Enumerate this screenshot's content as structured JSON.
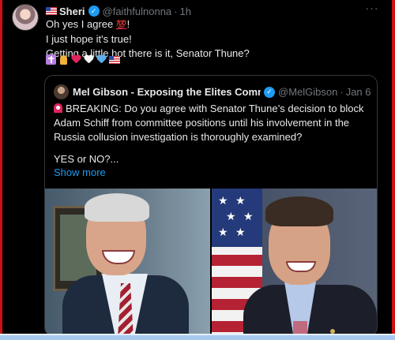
{
  "tweet": {
    "author_name": "Sheri",
    "handle": "@faithfulnonna",
    "separator": "·",
    "time": "1h",
    "more_label": "···",
    "lines": {
      "line1_text": "Oh yes I agree ",
      "line1_emoji": "💯",
      "line1_end": "!",
      "line2": "I just hope it's true!",
      "line3": "Getting a little hot there is it, Senator Thune?"
    },
    "emojis": [
      "latin-cross",
      "folded-hands",
      "red-heart",
      "white-heart",
      "blue-heart",
      "us-flag"
    ]
  },
  "quote": {
    "author_name": "Mel Gibson - Exposing the Elites Comment",
    "handle": "@MelGibson",
    "separator": "·",
    "date": "Jan 6",
    "text": "BREAKING: Do you agree with Senator Thune’s decision to block Adam Schiff from committee positions until his involvement in the Russia collusion investigation is thoroughly examined?",
    "question": "YES or NO?...",
    "show_more": "Show more",
    "media": [
      {
        "subject": "smiling man with white hair, navy suit and striped tie"
      },
      {
        "subject": "man in dark suit in front of American flag"
      }
    ]
  },
  "colors": {
    "background": "#000000",
    "text": "#e7e9ea",
    "muted": "#71767b",
    "link": "#1d9bf0",
    "verified": "#1d9bf0",
    "border": "#333639",
    "frame_red": "#cf1010"
  }
}
